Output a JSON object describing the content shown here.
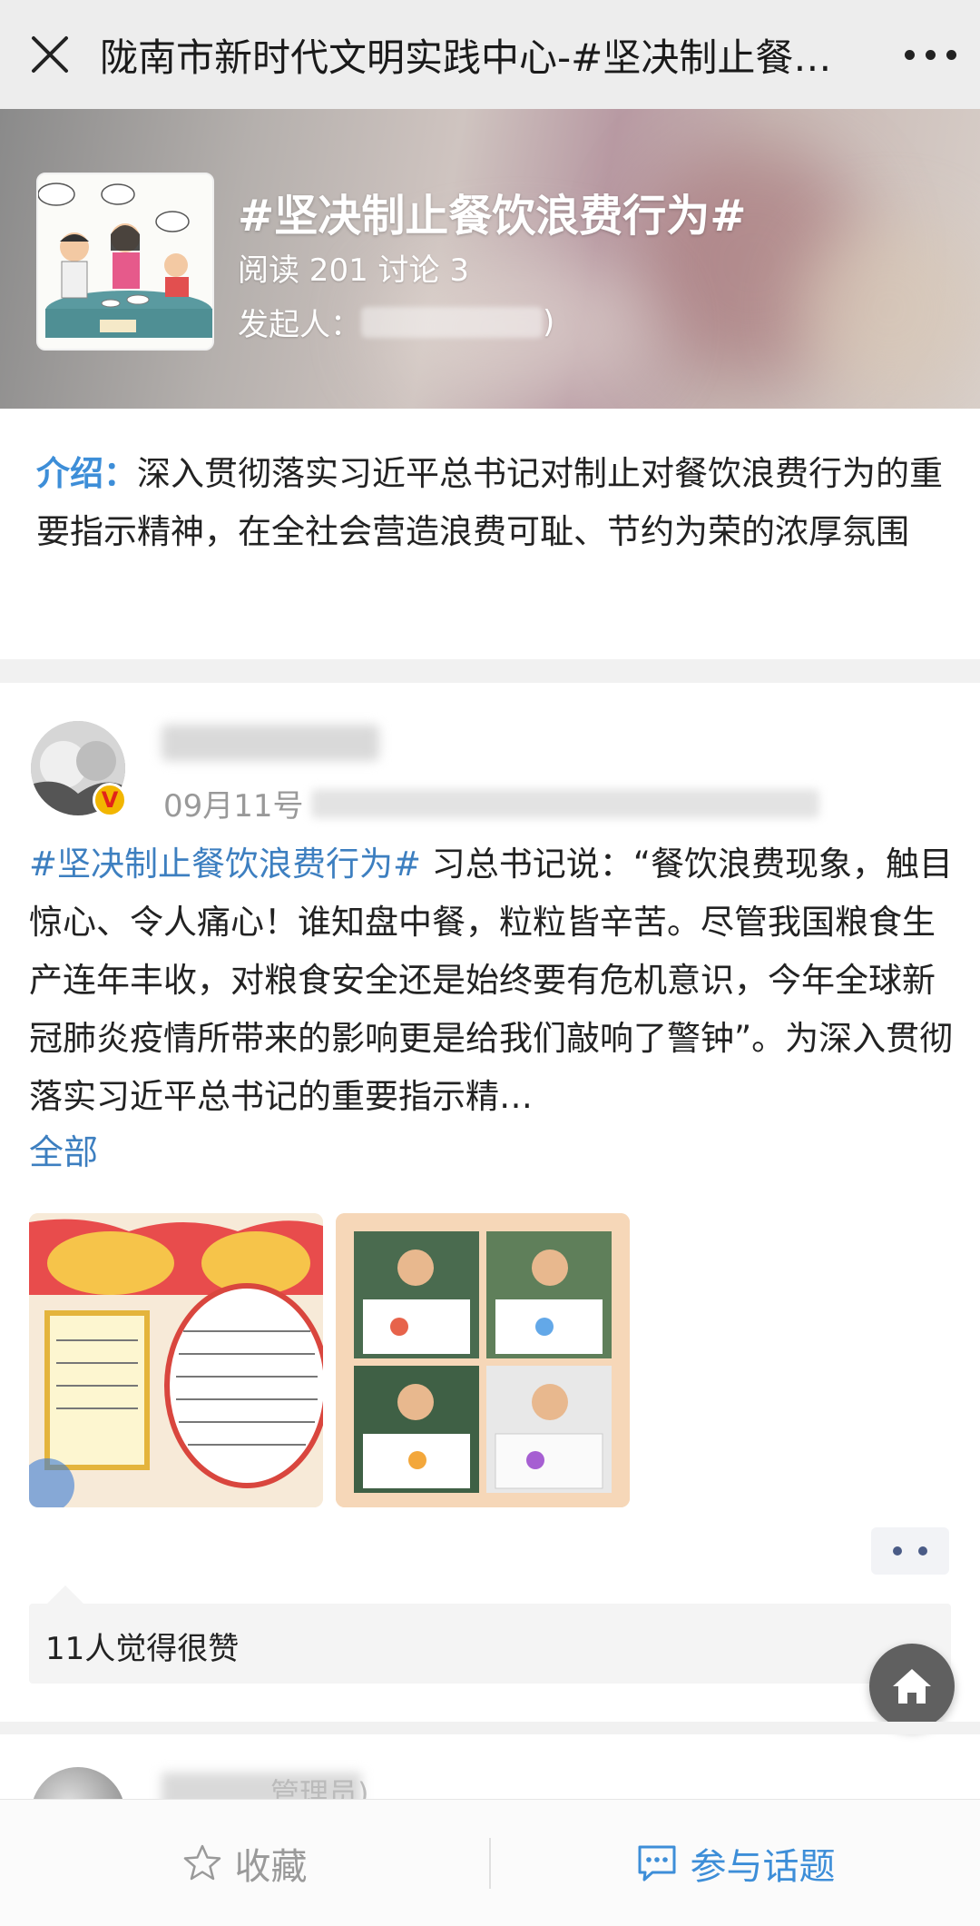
{
  "header": {
    "title": "陇南市新时代文明实践中心-#坚决制止餐饮浪费行为#"
  },
  "topic": {
    "title": "#坚决制止餐饮浪费行为#",
    "stats": "阅读 201 讨论 3",
    "initiator_label": "发起人：",
    "initiator_suffix": ")"
  },
  "intro": {
    "label": "介绍：",
    "text": "深入贯彻落实习近平总书记对制止对餐饮浪费行为的重要指示精神，在全社会营造浪费可耻、节约为荣的浓厚氛围"
  },
  "post": {
    "date": "09月11号",
    "hashtag": "#坚决制止餐饮浪费行为#",
    "body": " 习总书记说：“餐饮浪费现象，触目惊心、令人痛心！谁知盘中餐，粒粒皆辛苦。尽管我国粮食生产连年丰收，对粮食安全还是始终要有危机意识，今年全球新冠肺炎疫情所带来的影响更是给我们敲响了警钟”。为深入贯彻落实习近平总书记的重要指示精…",
    "expand_label": "全部",
    "likes": "11人觉得很赞",
    "badge": "V"
  },
  "post2": {
    "author_suffix": "管理员)"
  },
  "bottom_bar": {
    "favorite_label": "收藏",
    "join_label": "参与话题"
  }
}
